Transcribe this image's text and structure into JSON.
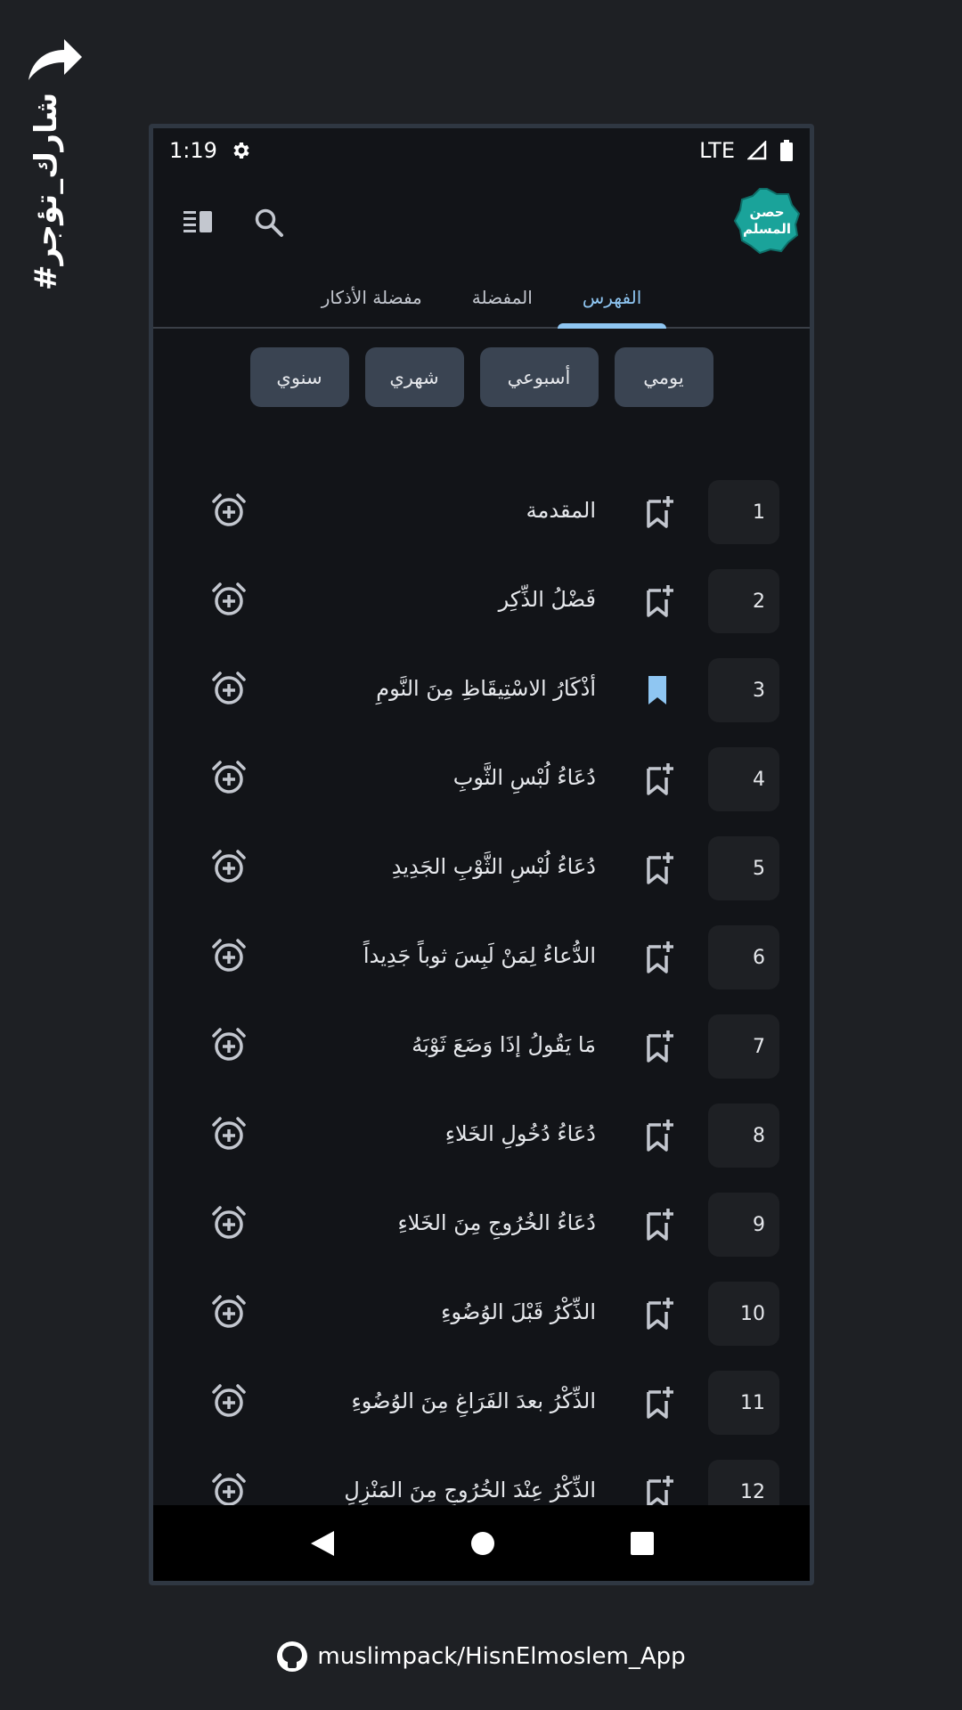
{
  "promo": {
    "share_hashtag": "#شارك_تؤجر"
  },
  "status_bar": {
    "time": "1:19",
    "network": "LTE"
  },
  "app_bar": {
    "logo_text": "حصن المسلم"
  },
  "tabs": [
    {
      "label": "الفهرس",
      "active": true
    },
    {
      "label": "المفضلة",
      "active": false
    },
    {
      "label": "مفضلة الأذكار",
      "active": false
    }
  ],
  "chips": [
    "يومي",
    "أسبوعي",
    "شهري",
    "سنوي"
  ],
  "items": [
    {
      "number": "1",
      "title": "المقدمة",
      "bookmarked": false
    },
    {
      "number": "2",
      "title": "فَضْلُ الذِّكِر",
      "bookmarked": false
    },
    {
      "number": "3",
      "title": "أذْكَارُ الاسْتِيقَاظِ مِنَ النَّومِ",
      "bookmarked": true
    },
    {
      "number": "4",
      "title": "دُعَاءُ لُبْسِ الثَّوبِ",
      "bookmarked": false
    },
    {
      "number": "5",
      "title": "دُعَاءُ لُبْسِ الثَّوْبِ الجَدِيدِ",
      "bookmarked": false
    },
    {
      "number": "6",
      "title": "الدُّعاءُ لِمَنْ لَبِسَ ثوباً جَدِيداً",
      "bookmarked": false
    },
    {
      "number": "7",
      "title": "مَا يَقُولُ إذَا وَضَعَ ثَوْبَهُ",
      "bookmarked": false
    },
    {
      "number": "8",
      "title": "دُعَاءُ دُخُولِ الخَلاءِ",
      "bookmarked": false
    },
    {
      "number": "9",
      "title": "دُعَاءُ الخُرُوجِ مِنَ الخَلاءِ",
      "bookmarked": false
    },
    {
      "number": "10",
      "title": "الذِّكْرُ قَبْلَ الوُضُوءِ",
      "bookmarked": false
    },
    {
      "number": "11",
      "title": "الذِّكْرُ بعدَ الفَرَاغِ مِنَ الوُضُوءِ",
      "bookmarked": false
    },
    {
      "number": "12",
      "title": "الذِّكْرُ عِنْدَ الخُرُوجِ مِنَ المَنْزِلِ",
      "bookmarked": false
    }
  ],
  "footer": {
    "repo": "muslimpack/HisnElmoslem_App"
  },
  "colors": {
    "accent": "#8fc6f2",
    "logo_bg": "#1aa39a",
    "chip_bg": "#3a4452",
    "background": "#121418"
  }
}
